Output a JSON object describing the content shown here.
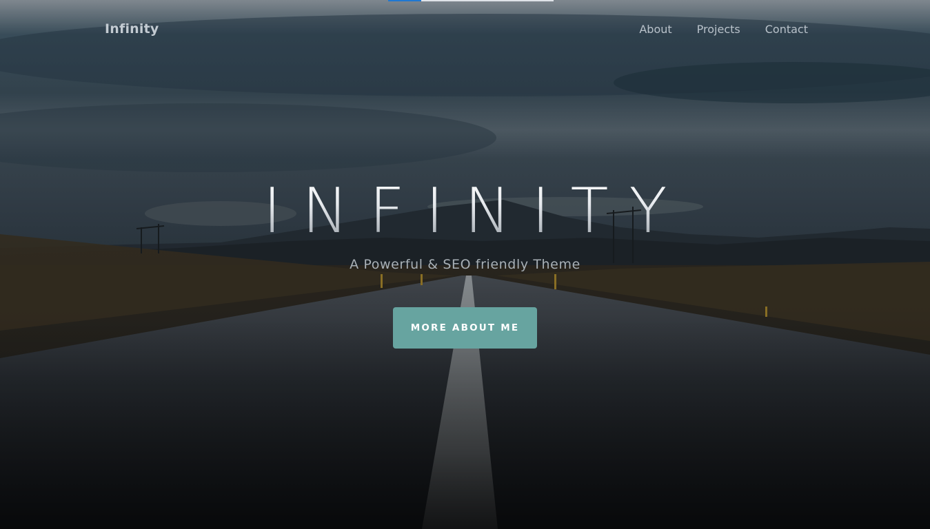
{
  "header": {
    "brand": "Infinity",
    "nav": [
      {
        "label": "About"
      },
      {
        "label": "Projects"
      },
      {
        "label": "Contact"
      }
    ],
    "scroll_progress": 0.2
  },
  "hero": {
    "title": "INFINITY",
    "subtitle": "A Powerful & SEO friendly Theme",
    "cta_label": "MORE ABOUT ME",
    "background_image": "dark-road-mountains-cloudy-sky"
  },
  "colors": {
    "accent": "#67a4a0",
    "progress": "#1f78d1",
    "nav_text": "#b9c2ca"
  }
}
